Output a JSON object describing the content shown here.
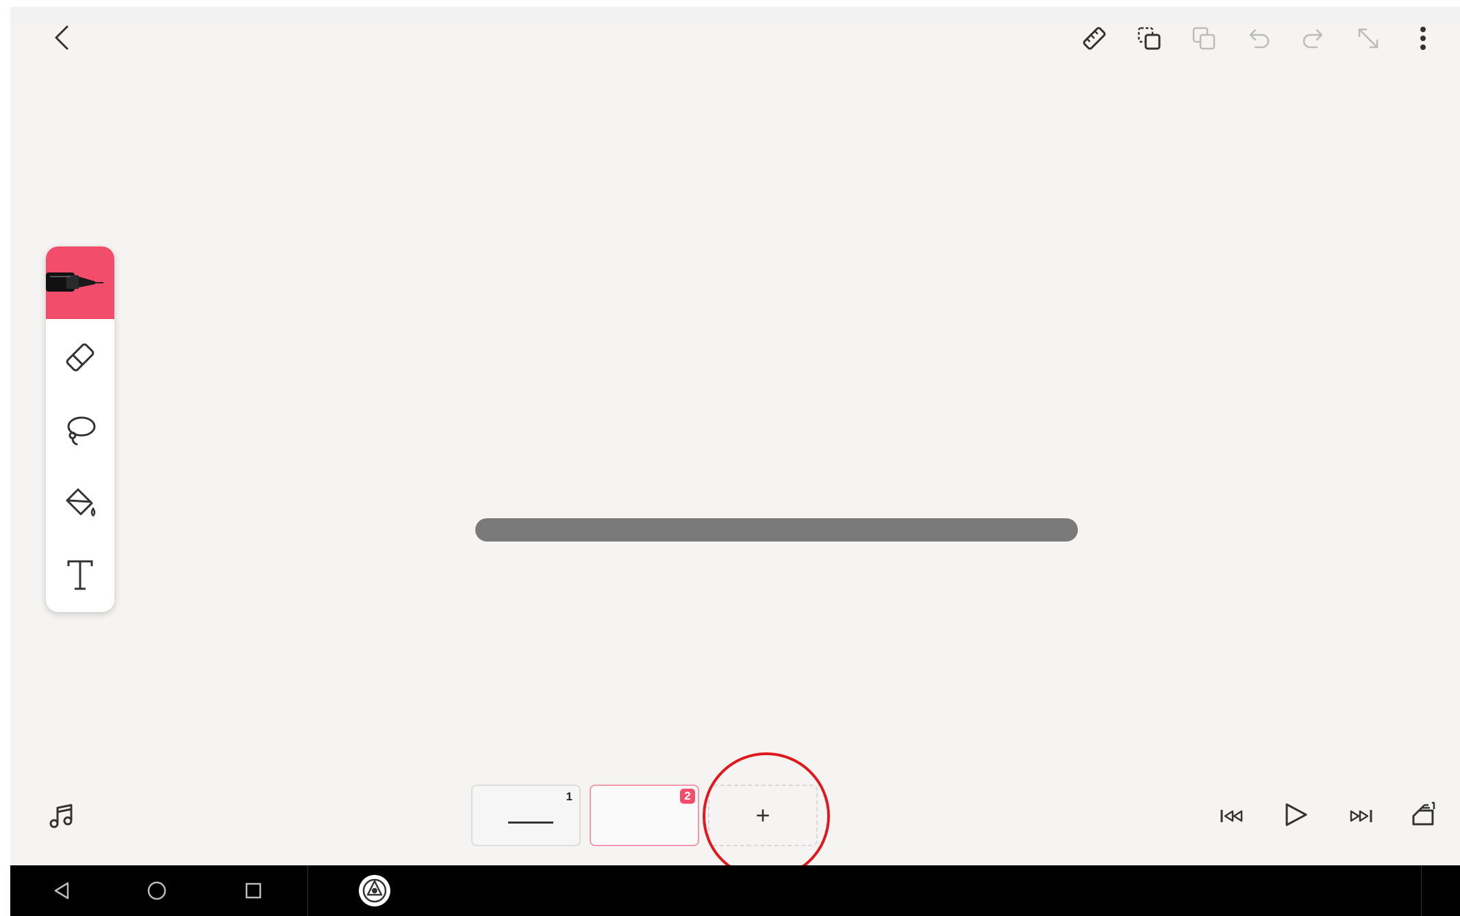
{
  "colors": {
    "accent": "#f24e6c",
    "canvas": "#f5f4f2",
    "stroke": "#7a7a7a",
    "highlight_circle": "#e0191e",
    "navbar": "#000000"
  },
  "top_toolbar": {
    "icons": [
      "back-icon",
      "ruler-icon",
      "copy-frame-icon",
      "paste-frame-icon",
      "undo-icon",
      "redo-icon",
      "expand-icon",
      "more-vertical-icon"
    ]
  },
  "tool_panel": {
    "tools": [
      "pen-icon",
      "eraser-icon",
      "lasso-icon",
      "fill-bucket-icon",
      "text-icon"
    ],
    "selected": "pen-icon"
  },
  "frames": {
    "frame1_number": "1",
    "frame2_number": "2",
    "add_label": "+",
    "selected": "2"
  },
  "playback": {
    "icons": [
      "skip-to-start-icon",
      "play-icon",
      "skip-to-end-icon",
      "onion-skin-icon"
    ]
  },
  "bottom_left": {
    "icon": "music-icon"
  },
  "system_nav": {
    "icons": [
      "nav-back-icon",
      "nav-home-icon",
      "nav-recents-icon",
      "app-icon"
    ]
  }
}
